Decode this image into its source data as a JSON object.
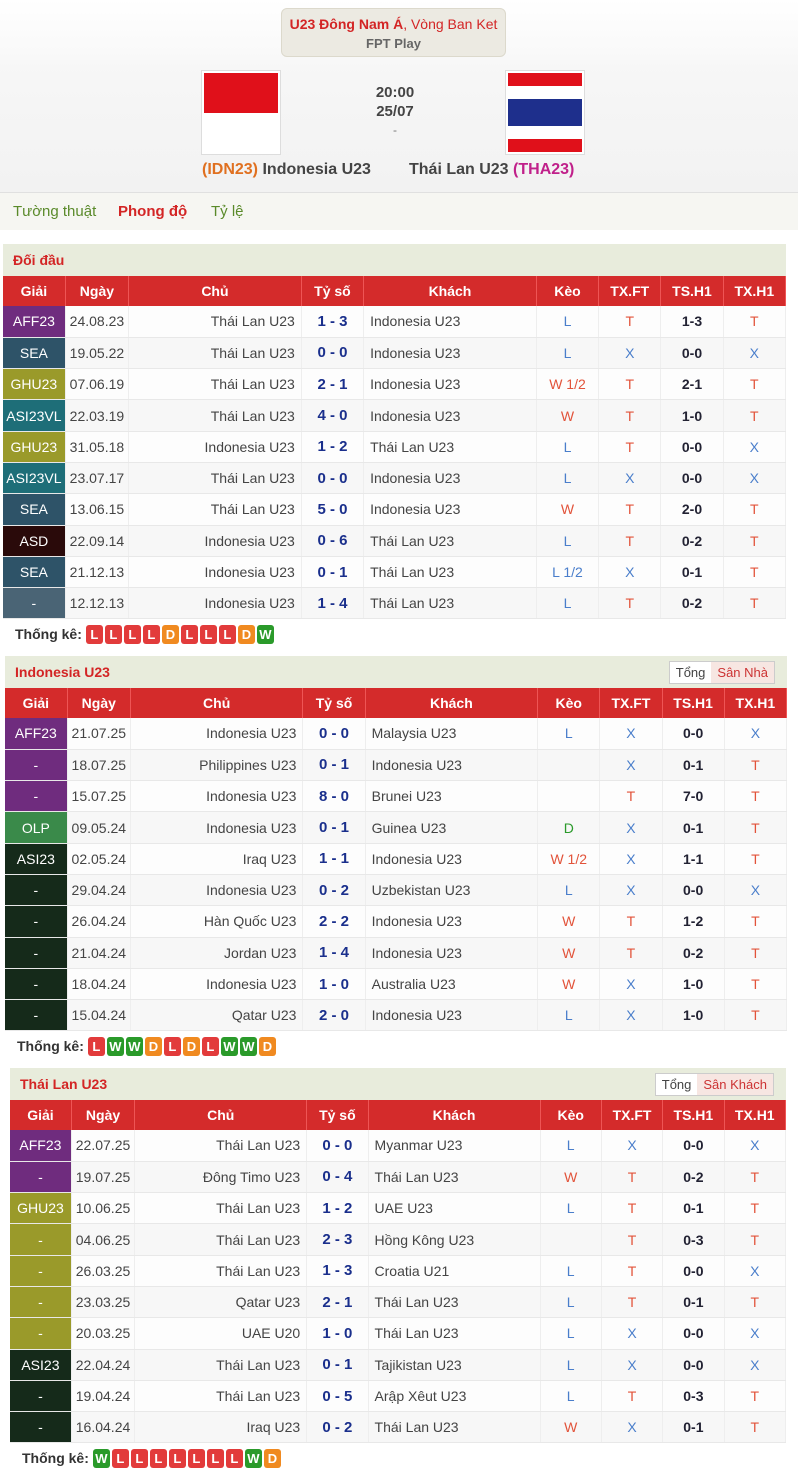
{
  "header": {
    "league_bold": "U23 Đông Nam Á",
    "league_rest": ", Vòng Ban Ket",
    "broadcaster": "FPT Play",
    "time": "20:00",
    "date": "25/07",
    "dash": "-",
    "home_code": "(IDN23)",
    "home_name": "Indonesia U23",
    "away_name": "Thái Lan U23",
    "away_code": "(THA23)"
  },
  "tabs": [
    "Tường thuật",
    "Phong độ",
    "Tỷ lệ"
  ],
  "colors": {
    "accent": "#d42b2b",
    "win": "#2a9a2a",
    "loss": "#e23b3b",
    "draw": "#f08a20"
  },
  "columns": [
    "Giải",
    "Ngày",
    "Chủ",
    "Tỷ số",
    "Khách",
    "Kèo",
    "TX.FT",
    "TS.H1",
    "TX.H1"
  ],
  "stats_label": "Thống kê:",
  "sections": [
    {
      "title": "Đối đầu",
      "toggle": null,
      "rows": [
        {
          "lg": "AFF23",
          "lgc": "#6f2c7e",
          "date": "24.08.23",
          "home": "Thái Lan U23",
          "score": "1 - 3",
          "away": "Indonesia U23",
          "keo": "L",
          "txft": "T",
          "tsh1": "1-3",
          "txh1": "T"
        },
        {
          "lg": "SEA",
          "lgc": "#2e5368",
          "date": "19.05.22",
          "home": "Thái Lan U23",
          "score": "0 - 0",
          "away": "Indonesia U23",
          "keo": "L",
          "txft": "X",
          "tsh1": "0-0",
          "txh1": "X"
        },
        {
          "lg": "GHU23",
          "lgc": "#9a9a2a",
          "date": "07.06.19",
          "home": "Thái Lan U23",
          "score": "2 - 1",
          "away": "Indonesia U23",
          "keo": "W 1/2",
          "txft": "T",
          "tsh1": "2-1",
          "txh1": "T"
        },
        {
          "lg": "ASI23VL",
          "lgc": "#1e6e78",
          "date": "22.03.19",
          "home": "Thái Lan U23",
          "score": "4 - 0",
          "away": "Indonesia U23",
          "keo": "W",
          "txft": "T",
          "tsh1": "1-0",
          "txh1": "T"
        },
        {
          "lg": "GHU23",
          "lgc": "#9a9a2a",
          "date": "31.05.18",
          "home": "Indonesia U23",
          "score": "1 - 2",
          "away": "Thái Lan U23",
          "keo": "L",
          "txft": "T",
          "tsh1": "0-0",
          "txh1": "X"
        },
        {
          "lg": "ASI23VL",
          "lgc": "#1e6e78",
          "date": "23.07.17",
          "home": "Thái Lan U23",
          "score": "0 - 0",
          "away": "Indonesia U23",
          "keo": "L",
          "txft": "X",
          "tsh1": "0-0",
          "txh1": "X"
        },
        {
          "lg": "SEA",
          "lgc": "#2e5368",
          "date": "13.06.15",
          "home": "Thái Lan U23",
          "score": "5 - 0",
          "away": "Indonesia U23",
          "keo": "W",
          "txft": "T",
          "tsh1": "2-0",
          "txh1": "T"
        },
        {
          "lg": "ASD",
          "lgc": "#2a0a0a",
          "date": "22.09.14",
          "home": "Indonesia U23",
          "score": "0 - 6",
          "away": "Thái Lan U23",
          "keo": "L",
          "txft": "T",
          "tsh1": "0-2",
          "txh1": "T"
        },
        {
          "lg": "SEA",
          "lgc": "#2e5368",
          "date": "21.12.13",
          "home": "Indonesia U23",
          "score": "0 - 1",
          "away": "Thái Lan U23",
          "keo": "L 1/2",
          "txft": "X",
          "tsh1": "0-1",
          "txh1": "T"
        },
        {
          "lg": "-",
          "lgc": "#4a6475",
          "date": "12.12.13",
          "home": "Indonesia U23",
          "score": "1 - 4",
          "away": "Thái Lan U23",
          "keo": "L",
          "txft": "T",
          "tsh1": "0-2",
          "txh1": "T"
        }
      ],
      "form": [
        "L",
        "L",
        "L",
        "L",
        "D",
        "L",
        "L",
        "L",
        "D",
        "W"
      ]
    },
    {
      "title": "Indonesia U23",
      "toggle": [
        "Tổng",
        "Sân Nhà"
      ],
      "rows": [
        {
          "lg": "AFF23",
          "lgc": "#6f2c7e",
          "date": "21.07.25",
          "home": "Indonesia U23",
          "score": "0 - 0",
          "away": "Malaysia U23",
          "keo": "L",
          "txft": "X",
          "tsh1": "0-0",
          "txh1": "X"
        },
        {
          "lg": "-",
          "lgc": "#6f2c7e",
          "date": "18.07.25",
          "home": "Philippines U23",
          "score": "0 - 1",
          "away": "Indonesia U23",
          "keo": "",
          "txft": "X",
          "tsh1": "0-1",
          "txh1": "T"
        },
        {
          "lg": "-",
          "lgc": "#6f2c7e",
          "date": "15.07.25",
          "home": "Indonesia U23",
          "score": "8 - 0",
          "away": "Brunei U23",
          "keo": "",
          "txft": "T",
          "tsh1": "7-0",
          "txh1": "T"
        },
        {
          "lg": "OLP",
          "lgc": "#3a8a4a",
          "date": "09.05.24",
          "home": "Indonesia U23",
          "score": "0 - 1",
          "away": "Guinea U23",
          "keo": "D",
          "txft": "X",
          "tsh1": "0-1",
          "txh1": "T"
        },
        {
          "lg": "ASI23",
          "lgc": "#152a1a",
          "date": "02.05.24",
          "home": "Iraq U23",
          "score": "1 - 1",
          "away": "Indonesia U23",
          "keo": "W 1/2",
          "txft": "X",
          "tsh1": "1-1",
          "txh1": "T"
        },
        {
          "lg": "-",
          "lgc": "#152a1a",
          "date": "29.04.24",
          "home": "Indonesia U23",
          "score": "0 - 2",
          "away": "Uzbekistan U23",
          "keo": "L",
          "txft": "X",
          "tsh1": "0-0",
          "txh1": "X"
        },
        {
          "lg": "-",
          "lgc": "#152a1a",
          "date": "26.04.24",
          "home": "Hàn Quốc U23",
          "score": "2 - 2",
          "away": "Indonesia U23",
          "keo": "W",
          "txft": "T",
          "tsh1": "1-2",
          "txh1": "T"
        },
        {
          "lg": "-",
          "lgc": "#152a1a",
          "date": "21.04.24",
          "home": "Jordan U23",
          "score": "1 - 4",
          "away": "Indonesia U23",
          "keo": "W",
          "txft": "T",
          "tsh1": "0-2",
          "txh1": "T"
        },
        {
          "lg": "-",
          "lgc": "#152a1a",
          "date": "18.04.24",
          "home": "Indonesia U23",
          "score": "1 - 0",
          "away": "Australia U23",
          "keo": "W",
          "txft": "X",
          "tsh1": "1-0",
          "txh1": "T"
        },
        {
          "lg": "-",
          "lgc": "#152a1a",
          "date": "15.04.24",
          "home": "Qatar U23",
          "score": "2 - 0",
          "away": "Indonesia U23",
          "keo": "L",
          "txft": "X",
          "tsh1": "1-0",
          "txh1": "T"
        }
      ],
      "form": [
        "L",
        "W",
        "W",
        "D",
        "L",
        "D",
        "L",
        "W",
        "W",
        "D"
      ]
    },
    {
      "title": "Thái Lan U23",
      "toggle": [
        "Tổng",
        "Sân Khách"
      ],
      "rows": [
        {
          "lg": "AFF23",
          "lgc": "#6f2c7e",
          "date": "22.07.25",
          "home": "Thái Lan U23",
          "score": "0 - 0",
          "away": "Myanmar U23",
          "keo": "L",
          "txft": "X",
          "tsh1": "0-0",
          "txh1": "X"
        },
        {
          "lg": "-",
          "lgc": "#6f2c7e",
          "date": "19.07.25",
          "home": "Đông Timo U23",
          "score": "0 - 4",
          "away": "Thái Lan U23",
          "keo": "W",
          "txft": "T",
          "tsh1": "0-2",
          "txh1": "T"
        },
        {
          "lg": "GHU23",
          "lgc": "#9a9a2a",
          "date": "10.06.25",
          "home": "Thái Lan U23",
          "score": "1 - 2",
          "away": "UAE U23",
          "keo": "L",
          "txft": "T",
          "tsh1": "0-1",
          "txh1": "T"
        },
        {
          "lg": "-",
          "lgc": "#9a9a2a",
          "date": "04.06.25",
          "home": "Thái Lan U23",
          "score": "2 - 3",
          "away": "Hồng Kông U23",
          "keo": "",
          "txft": "T",
          "tsh1": "0-3",
          "txh1": "T"
        },
        {
          "lg": "-",
          "lgc": "#9a9a2a",
          "date": "26.03.25",
          "home": "Thái Lan U23",
          "score": "1 - 3",
          "away": "Croatia U21",
          "keo": "L",
          "txft": "T",
          "tsh1": "0-0",
          "txh1": "X"
        },
        {
          "lg": "-",
          "lgc": "#9a9a2a",
          "date": "23.03.25",
          "home": "Qatar U23",
          "score": "2 - 1",
          "away": "Thái Lan U23",
          "keo": "L",
          "txft": "T",
          "tsh1": "0-1",
          "txh1": "T"
        },
        {
          "lg": "-",
          "lgc": "#9a9a2a",
          "date": "20.03.25",
          "home": "UAE U20",
          "score": "1 - 0",
          "away": "Thái Lan U23",
          "keo": "L",
          "txft": "X",
          "tsh1": "0-0",
          "txh1": "X"
        },
        {
          "lg": "ASI23",
          "lgc": "#152a1a",
          "date": "22.04.24",
          "home": "Thái Lan U23",
          "score": "0 - 1",
          "away": "Tajikistan U23",
          "keo": "L",
          "txft": "X",
          "tsh1": "0-0",
          "txh1": "X"
        },
        {
          "lg": "-",
          "lgc": "#152a1a",
          "date": "19.04.24",
          "home": "Thái Lan U23",
          "score": "0 - 5",
          "away": "Arập Xêut U23",
          "keo": "L",
          "txft": "T",
          "tsh1": "0-3",
          "txh1": "T"
        },
        {
          "lg": "-",
          "lgc": "#152a1a",
          "date": "16.04.24",
          "home": "Iraq U23",
          "score": "0 - 2",
          "away": "Thái Lan U23",
          "keo": "W",
          "txft": "X",
          "tsh1": "0-1",
          "txh1": "T"
        }
      ],
      "form": [
        "W",
        "L",
        "L",
        "L",
        "L",
        "L",
        "L",
        "L",
        "W",
        "D"
      ]
    }
  ]
}
